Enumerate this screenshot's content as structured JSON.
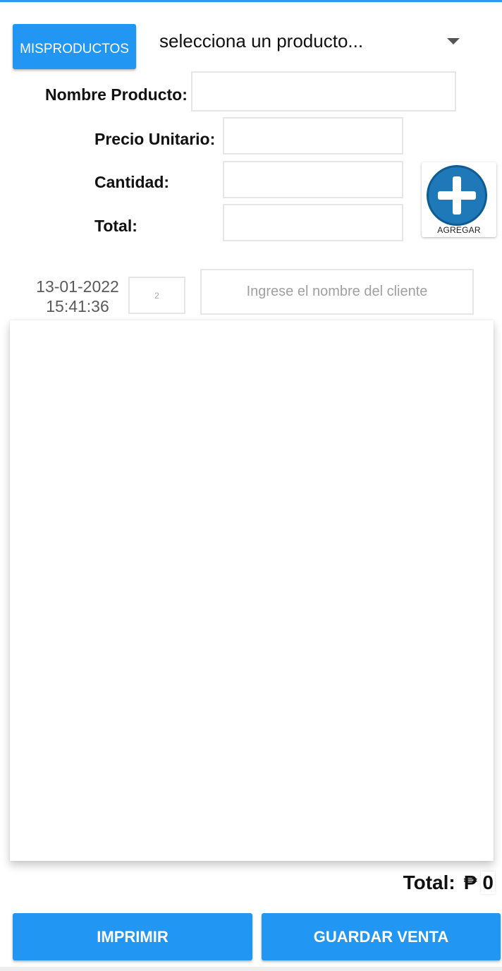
{
  "header": {
    "my_products_line1": "MIS",
    "my_products_line2": "PRODUCTOS",
    "product_select": "selecciona un producto..."
  },
  "form": {
    "name_label": "Nombre Producto:",
    "unit_price_label": "Precio Unitario:",
    "quantity_label": "Cantidad:",
    "total_label": "Total:",
    "name_value": "",
    "unit_price_value": "",
    "quantity_value": "",
    "total_value": "",
    "add_label": "AGREGAR"
  },
  "sale": {
    "date": "13-01-2022",
    "time": "15:41:36",
    "number": "2",
    "client_placeholder": "Ingrese el nombre del cliente",
    "client_value": ""
  },
  "items": [],
  "summary": {
    "total_label": "Total:",
    "currency": "₱",
    "total_value": "0"
  },
  "actions": {
    "print_label": "IMPRIMIR",
    "save_label": "GUARDAR VENTA"
  },
  "colors": {
    "primary": "#2196f3",
    "add_icon": "#1f79b9"
  },
  "icons": {
    "dropdown": "dropdown-arrow-icon",
    "add": "plus-circle-icon"
  }
}
